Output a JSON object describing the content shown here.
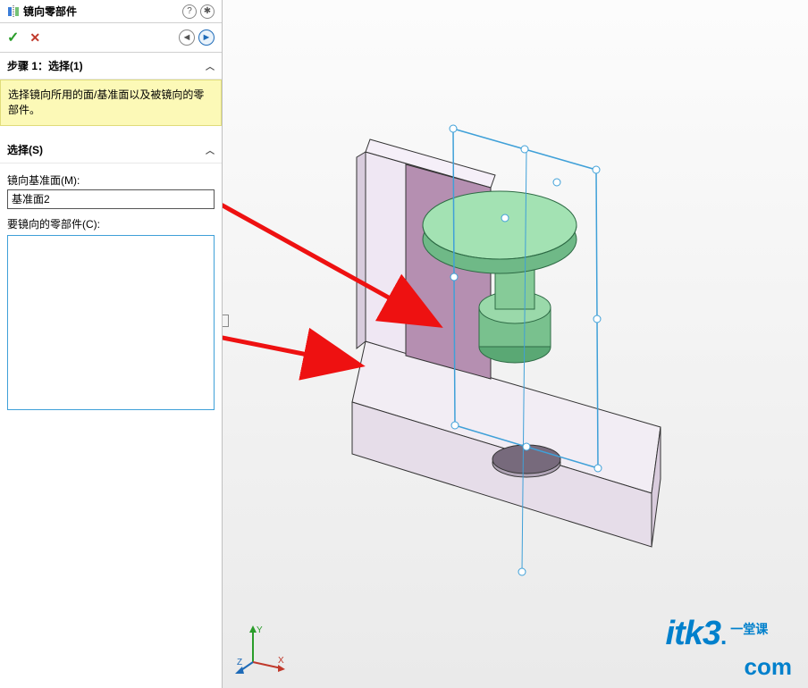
{
  "header": {
    "title": "镜向零部件"
  },
  "step1": {
    "title": "步骤 1：选择(1)",
    "hint": "选择镜向所用的面/基准面以及被镜向的零部件。"
  },
  "selection": {
    "title": "选择(S)",
    "mirror_plane_label": "镜向基准面(M):",
    "mirror_plane_value": "基准面2",
    "components_label": "要镜向的零部件(C):"
  },
  "watermark": {
    "main": "itk3",
    "dot": ".",
    "tag": "一堂课",
    "com": "com"
  },
  "icons": {
    "help": "?",
    "pin": "✱",
    "ok": "✓",
    "cancel": "✕",
    "back": "◄",
    "forward": "►",
    "chevron": "︿"
  }
}
